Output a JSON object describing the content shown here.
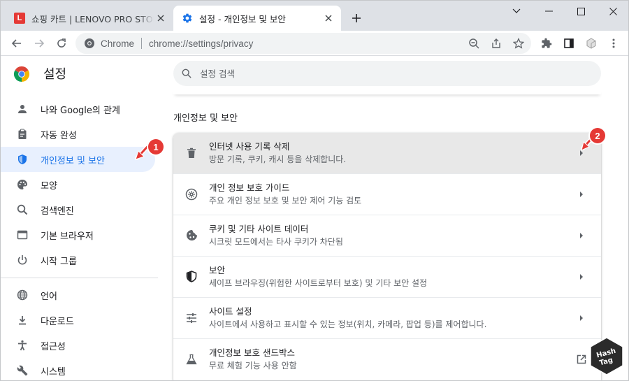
{
  "tabs": [
    {
      "title": "쇼핑 카트 | LENOVO PRO STORE",
      "favicon": "lenovo-favicon",
      "favicon_letter": "L",
      "active": false
    },
    {
      "title": "설정 - 개인정보 및 보안",
      "favicon": "gear-icon",
      "active": true
    }
  ],
  "toolbar": {
    "origin": "Chrome",
    "url": "chrome://settings/privacy"
  },
  "header": {
    "title": "설정",
    "search_placeholder": "설정 검색"
  },
  "sidebar": {
    "items": [
      {
        "label": "나와 Google의 관계",
        "icon": "person-icon"
      },
      {
        "label": "자동 완성",
        "icon": "clipboard-icon"
      },
      {
        "label": "개인정보 및 보안",
        "icon": "shield-icon",
        "selected": true
      },
      {
        "label": "모양",
        "icon": "palette-icon"
      },
      {
        "label": "검색엔진",
        "icon": "search-icon"
      },
      {
        "label": "기본 브라우저",
        "icon": "browser-icon"
      },
      {
        "label": "시작 그룹",
        "icon": "power-icon"
      },
      {
        "label": "언어",
        "icon": "globe-icon"
      },
      {
        "label": "다운로드",
        "icon": "download-icon"
      },
      {
        "label": "접근성",
        "icon": "accessibility-icon"
      },
      {
        "label": "시스템",
        "icon": "wrench-icon"
      }
    ]
  },
  "main": {
    "section_title": "개인정보 및 보안",
    "rows": [
      {
        "label": "인터넷 사용 기록 삭제",
        "sub": "방문 기록, 쿠키, 캐시 등을 삭제합니다.",
        "icon": "trash-icon",
        "action": "arrow"
      },
      {
        "label": "개인 정보 보호 가이드",
        "sub": "주요 개인 정보 보호 및 보안 제어 기능 검토",
        "icon": "compass-icon",
        "action": "arrow"
      },
      {
        "label": "쿠키 및 기타 사이트 데이터",
        "sub": "시크릿 모드에서는 타사 쿠키가 차단됨",
        "icon": "cookie-icon",
        "action": "arrow"
      },
      {
        "label": "보안",
        "sub": "세이프 브라우징(위험한 사이트로부터 보호) 및 기타 보안 설정",
        "icon": "security-shield-icon",
        "action": "arrow"
      },
      {
        "label": "사이트 설정",
        "sub": "사이트에서 사용하고 표시할 수 있는 정보(위치, 카메라, 팝업 등)를 제어합니다.",
        "icon": "tune-icon",
        "action": "arrow"
      },
      {
        "label": "개인정보 보호 샌드박스",
        "sub": "무료 체험 기능 사용 안함",
        "icon": "flask-icon",
        "action": "external-link"
      }
    ]
  },
  "annotations": [
    {
      "number": "1"
    },
    {
      "number": "2"
    }
  ],
  "watermark": {
    "line1": "Hash",
    "line2": "Tag"
  },
  "colors": {
    "accent": "#1a73e8",
    "selected_bg": "#e8f0fe",
    "highlight_row_bg": "#e8e8e8",
    "badge": "#e53935",
    "tabbar": "#dee1e6"
  }
}
